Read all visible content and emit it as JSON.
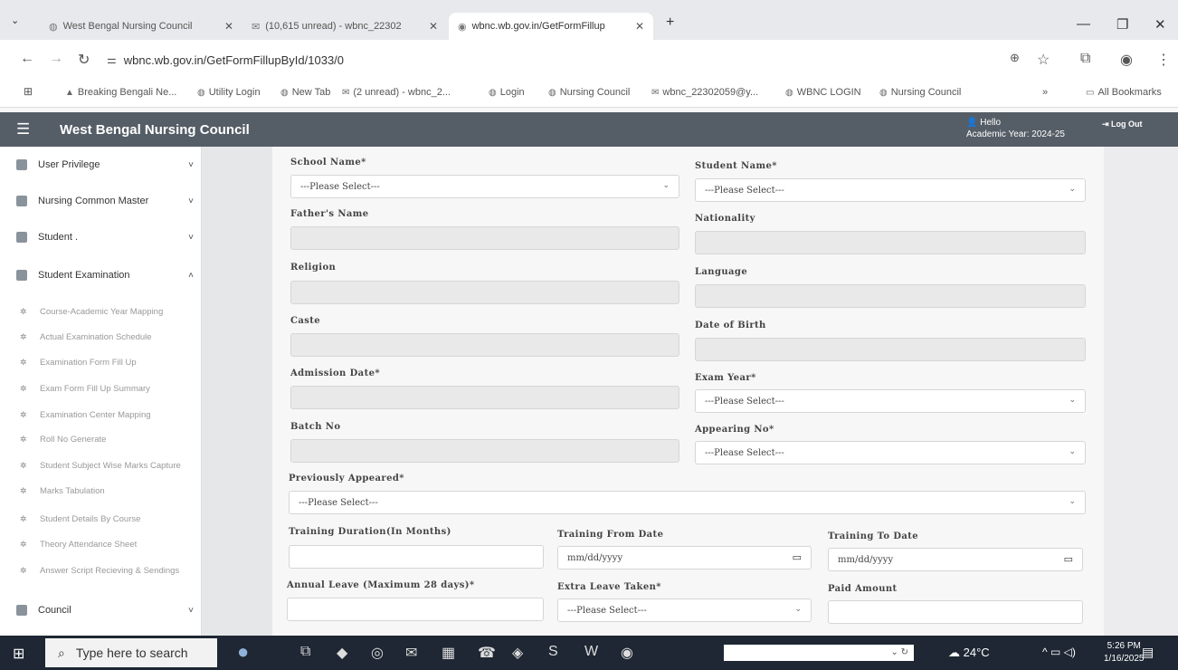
{
  "browser": {
    "tabs": [
      {
        "label": "West Bengal Nursing Council",
        "icon": "globe-icon"
      },
      {
        "label": "(10,615 unread) - wbnc_22302",
        "icon": "mail-icon"
      },
      {
        "label": "wbnc.wb.gov.in/GetFormFillup",
        "icon": "site-icon"
      }
    ],
    "new_tab": "+",
    "url": "wbnc.wb.gov.in/GetFormFillupById/1033/0",
    "bookmarks": [
      "Breaking Bengali Ne...",
      "Utility Login",
      "New Tab",
      "(2 unread) - wbnc_2...",
      "Login",
      "Nursing Council",
      "wbnc_22302059@y...",
      "WBNC LOGIN",
      "Nursing Council"
    ],
    "all_bookmarks": "All Bookmarks",
    "overflow": "»"
  },
  "header": {
    "title": "West Bengal Nursing Council",
    "hello": "Hello",
    "academic_year": "Academic Year: 2024-25",
    "logout": "Log Out"
  },
  "sidebar": {
    "groups": [
      {
        "label": "User Privilege",
        "chevron": "˅"
      },
      {
        "label": "Nursing Common Master",
        "chevron": "˅"
      },
      {
        "label": "Student .",
        "chevron": "˅"
      },
      {
        "label": "Student Examination",
        "chevron": "˄"
      }
    ],
    "sub_items": [
      "Course-Academic Year Mapping",
      "Actual Examination Schedule",
      "Examination Form Fill Up",
      "Exam Form Fill Up Summary",
      "Examination Center Mapping",
      "Roll No Generate",
      "Student Subject Wise Marks Capture",
      "Marks Tabulation",
      "Student Details By Course",
      "Theory Attendance Sheet",
      "Answer Script Recieving & Sendings"
    ],
    "council": {
      "label": "Council",
      "chevron": "˅"
    }
  },
  "form": {
    "school_name": {
      "label": "School Name*",
      "value": "---Please Select---"
    },
    "student_name": {
      "label": "Student Name*",
      "value": "---Please Select---"
    },
    "fathers_name": {
      "label": "Father's Name"
    },
    "nationality": {
      "label": "Nationality"
    },
    "religion": {
      "label": "Religion"
    },
    "language": {
      "label": "Language"
    },
    "caste": {
      "label": "Caste"
    },
    "dob": {
      "label": "Date of Birth"
    },
    "admission_date": {
      "label": "Admission Date*"
    },
    "exam_year": {
      "label": "Exam Year*",
      "value": "---Please Select---"
    },
    "batch_no": {
      "label": "Batch No"
    },
    "appearing_no": {
      "label": "Appearing No*",
      "value": "---Please Select---"
    },
    "previously_appeared": {
      "label": "Previously Appeared*",
      "value": "---Please Select---"
    },
    "training_duration": {
      "label": "Training Duration(In Months)"
    },
    "training_from": {
      "label": "Training From Date",
      "placeholder": "mm/dd/yyyy"
    },
    "training_to": {
      "label": "Training To Date",
      "placeholder": "mm/dd/yyyy"
    },
    "annual_leave": {
      "label": "Annual Leave (Maximum 28 days)*"
    },
    "extra_leave": {
      "label": "Extra Leave Taken*",
      "value": "---Please Select---"
    },
    "paid_amount": {
      "label": "Paid Amount"
    }
  },
  "taskbar": {
    "search_placeholder": "Type here to search",
    "weather": "24°C",
    "time": "5:26 PM",
    "date": "1/16/2025"
  }
}
